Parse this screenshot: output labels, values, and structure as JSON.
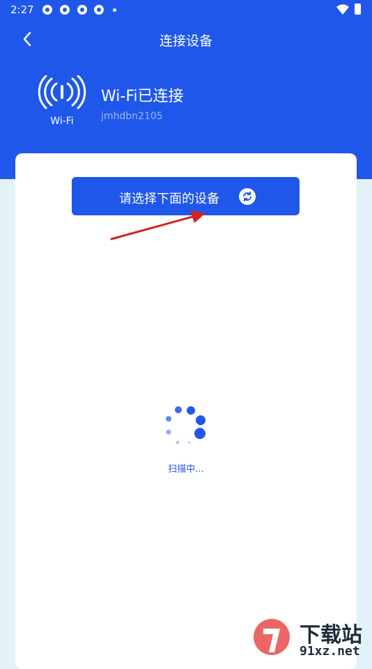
{
  "status_bar": {
    "time": "2:27"
  },
  "topbar": {
    "title": "连接设备"
  },
  "connection": {
    "icon_label": "Wi-Fi",
    "status": "Wi-Fi已连接",
    "ssid": "jmhdbn2105"
  },
  "select_button": {
    "label": "请选择下面的设备"
  },
  "scan": {
    "status": "扫描中..."
  },
  "watermark": {
    "text": "下载站",
    "url": "91xz.net"
  },
  "colors": {
    "primary": "#1f57eb",
    "background": "#e3f2f8",
    "card": "#ffffff",
    "arrow": "#d42222"
  }
}
